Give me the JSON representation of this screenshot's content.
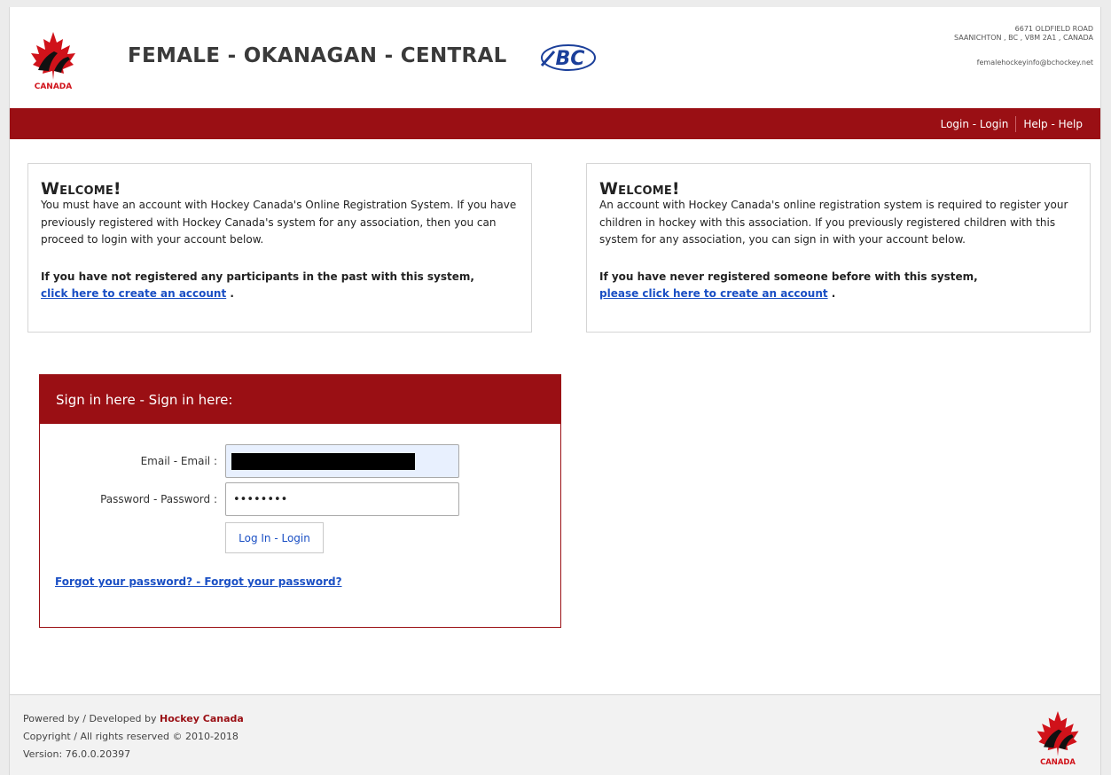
{
  "header": {
    "title": "FEMALE - OKANAGAN - CENTRAL",
    "logo_text": "CANADA",
    "bc_logo_text": "BC",
    "address_line1": "6671 OLDFIELD ROAD",
    "address_line2": "SAANICHTON , BC , V8M 2A1 , CANADA",
    "email": "femalehockeyinfo@bchockey.net"
  },
  "nav": {
    "login_label": "Login - Login",
    "help_label": "Help - Help"
  },
  "welcome_left": {
    "heading": "Welcome!",
    "body": "You must have an account with Hockey Canada's Online Registration System. If you have previously registered with Hockey Canada's system for any association, then you can proceed to login with your account below.",
    "bold_text": "If you have not registered any participants in the past with this system,",
    "link_label": "click here to create an account",
    "link_suffix": " ."
  },
  "welcome_right": {
    "heading": "Welcome!",
    "body": "An account with Hockey Canada's online registration system is required to register your children in hockey with this association. If you previously registered children with this system for any association, you can sign in with your account below.",
    "bold_text": "If you have never registered someone before with this system,",
    "link_label": "please click here to create an account",
    "link_suffix": " ."
  },
  "signin": {
    "title": "Sign in here - Sign in here:",
    "email_label": "Email - Email :",
    "email_value": "",
    "password_label": "Password - Password :",
    "password_value": "••••••••",
    "login_button": "Log In - Login",
    "forgot_link": "Forgot your password? - Forgot your password?"
  },
  "footer": {
    "powered_prefix": "Powered by / Developed by ",
    "powered_brand": "Hockey Canada",
    "copyright": "Copyright / All rights reserved © 2010-2018",
    "version": "Version: 76.0.0.20397",
    "logo_text": "CANADA"
  },
  "colors": {
    "brand_red": "#9a0f14",
    "link_blue": "#1a4fc4"
  }
}
